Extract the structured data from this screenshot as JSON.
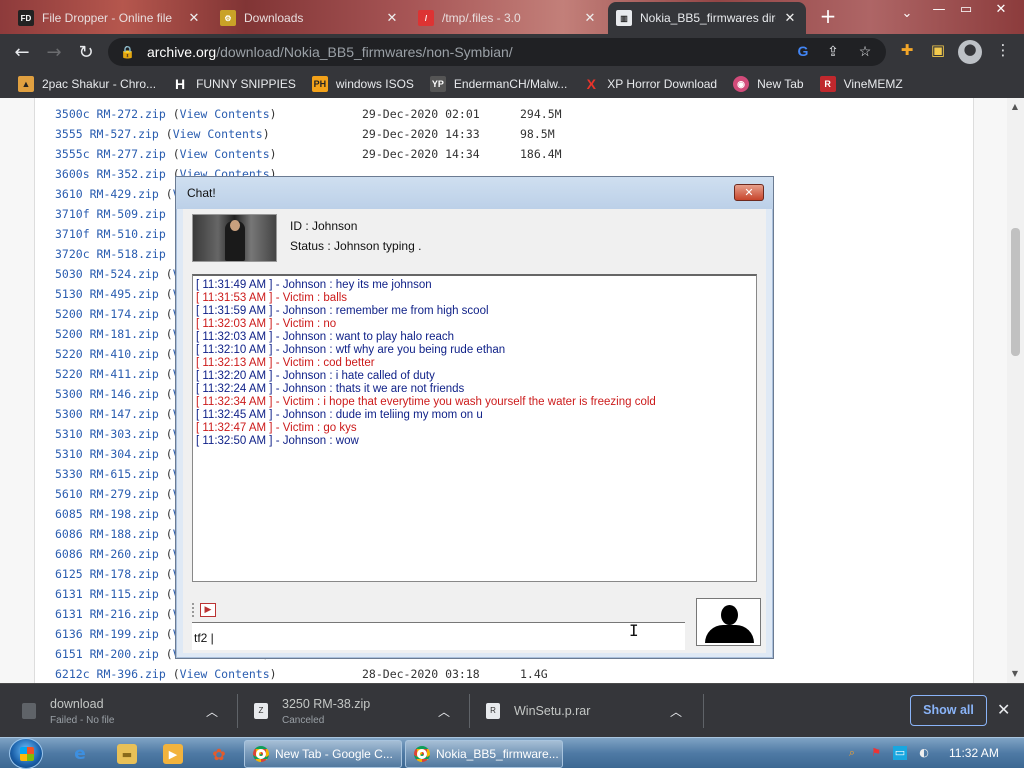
{
  "browser": {
    "tabs": [
      {
        "icon": "FD",
        "label": "File Dropper - Online file",
        "active": false
      },
      {
        "icon": "dl",
        "label": "Downloads",
        "active": false
      },
      {
        "icon": "tmp",
        "label": "/tmp/.files - 3.0",
        "active": false
      },
      {
        "icon": "archive",
        "label": "Nokia_BB5_firmwares dire",
        "active": true
      }
    ],
    "new_tab": "+",
    "window_controls": [
      "⌄",
      "—",
      "▭",
      "✕"
    ],
    "url_host": "archive.org",
    "url_path": "/download/Nokia_BB5_firmwares/non-Symbian/",
    "bookmarks": [
      {
        "label": "2pac Shakur - Chro...",
        "color": "#e0a040"
      },
      {
        "label": "FUNNY SNIPPIES",
        "color": "#ffffff"
      },
      {
        "label": "windows ISOS",
        "color": "#f3a21a"
      },
      {
        "label": "EndermanCH/Malw...",
        "color": "#555555"
      },
      {
        "label": "XP Horror Download",
        "color": "#e8332a"
      },
      {
        "label": "New Tab",
        "color": "#d24b7a"
      },
      {
        "label": "VineMEMZ",
        "color": "#c0282d"
      }
    ]
  },
  "listing": {
    "view_label": "View Contents",
    "rows": [
      {
        "file": "3500c RM-272.zip",
        "date": "29-Dec-2020 02:01",
        "size": "294.5M"
      },
      {
        "file": "3555 RM-527.zip",
        "date": "29-Dec-2020 14:33",
        "size": "98.5M"
      },
      {
        "file": "3555c RM-277.zip",
        "date": "29-Dec-2020 14:34",
        "size": "186.4M"
      },
      {
        "file": "3600s RM-352.zip",
        "date": "",
        "size": ""
      },
      {
        "file": "3610 RM-429.zip",
        "date": "",
        "size": ""
      },
      {
        "file": "3710f RM-509.zip",
        "date": "",
        "size": ""
      },
      {
        "file": "3710f RM-510.zip",
        "date": "",
        "size": ""
      },
      {
        "file": "3720c RM-518.zip",
        "date": "",
        "size": ""
      },
      {
        "file": "5030 RM-524.zip",
        "date": "",
        "size": ""
      },
      {
        "file": "5130 RM-495.zip",
        "date": "",
        "size": ""
      },
      {
        "file": "5200 RM-174.zip",
        "date": "",
        "size": ""
      },
      {
        "file": "5200 RM-181.zip",
        "date": "",
        "size": ""
      },
      {
        "file": "5220 RM-410.zip",
        "date": "",
        "size": ""
      },
      {
        "file": "5220 RM-411.zip",
        "date": "",
        "size": ""
      },
      {
        "file": "5300 RM-146.zip",
        "date": "",
        "size": ""
      },
      {
        "file": "5300 RM-147.zip",
        "date": "",
        "size": ""
      },
      {
        "file": "5310 RM-303.zip",
        "date": "",
        "size": ""
      },
      {
        "file": "5310 RM-304.zip",
        "date": "",
        "size": ""
      },
      {
        "file": "5330 RM-615.zip",
        "date": "",
        "size": ""
      },
      {
        "file": "5610 RM-279.zip",
        "date": "",
        "size": ""
      },
      {
        "file": "6085 RM-198.zip",
        "date": "",
        "size": ""
      },
      {
        "file": "6086 RM-188.zip",
        "date": "",
        "size": ""
      },
      {
        "file": "6086 RM-260.zip",
        "date": "",
        "size": ""
      },
      {
        "file": "6125 RM-178.zip",
        "date": "",
        "size": ""
      },
      {
        "file": "6131 RM-115.zip",
        "date": "",
        "size": ""
      },
      {
        "file": "6131 RM-216.zip",
        "date": "",
        "size": ""
      },
      {
        "file": "6136 RM-199.zip",
        "date": "",
        "size": ""
      },
      {
        "file": "6151 RM-200.zip",
        "date": "",
        "size": ""
      },
      {
        "file": "6212c RM-396.zip",
        "date": "28-Dec-2020 03:18",
        "size": "1.4G"
      }
    ]
  },
  "chat": {
    "title": "Chat!",
    "close": "✕",
    "id_line": "ID : Johnson",
    "status_line": "Status : Johnson typing .",
    "messages": [
      {
        "who": "j",
        "text": "[ 11:31:49 AM ] - Johnson : hey its me johnson"
      },
      {
        "who": "v",
        "text": "[ 11:31:53 AM ] - Victim : balls"
      },
      {
        "who": "j",
        "text": "[ 11:31:59 AM ] - Johnson : remember me from high scool"
      },
      {
        "who": "v",
        "text": "[ 11:32:03 AM ] - Victim : no"
      },
      {
        "who": "j",
        "text": "[ 11:32:03 AM ] - Johnson : want to play halo reach"
      },
      {
        "who": "j",
        "text": "[ 11:32:10 AM ] - Johnson : wtf why are you being rude ethan"
      },
      {
        "who": "v",
        "text": "[ 11:32:13 AM ] - Victim : cod better"
      },
      {
        "who": "j",
        "text": "[ 11:32:20 AM ] - Johnson : i hate called of duty"
      },
      {
        "who": "j",
        "text": "[ 11:32:24 AM ] - Johnson : thats it we are not friends"
      },
      {
        "who": "v",
        "text": "[ 11:32:34 AM ] - Victim : i hope that everytime you wash yourself the water is freezing cold"
      },
      {
        "who": "j",
        "text": "[ 11:32:45 AM ] - Johnson : dude im teliing my mom on u"
      },
      {
        "who": "v",
        "text": "[ 11:32:47 AM ] - Victim : go kys"
      },
      {
        "who": "j",
        "text": "[ 11:32:50 AM ] - Johnson : wow"
      }
    ],
    "input_value": "tf2 |"
  },
  "downloads": {
    "items": [
      {
        "name": "download",
        "status": "Failed - No file"
      },
      {
        "name": "3250 RM-38.zip",
        "status": "Canceled"
      },
      {
        "name": "WinSetu.p.rar",
        "status": ""
      }
    ],
    "show_all": "Show all",
    "close": "✕"
  },
  "taskbar": {
    "windows": [
      {
        "label": "New Tab - Google C..."
      },
      {
        "label": "Nokia_BB5_firmware..."
      }
    ],
    "clock": "11:32 AM"
  }
}
